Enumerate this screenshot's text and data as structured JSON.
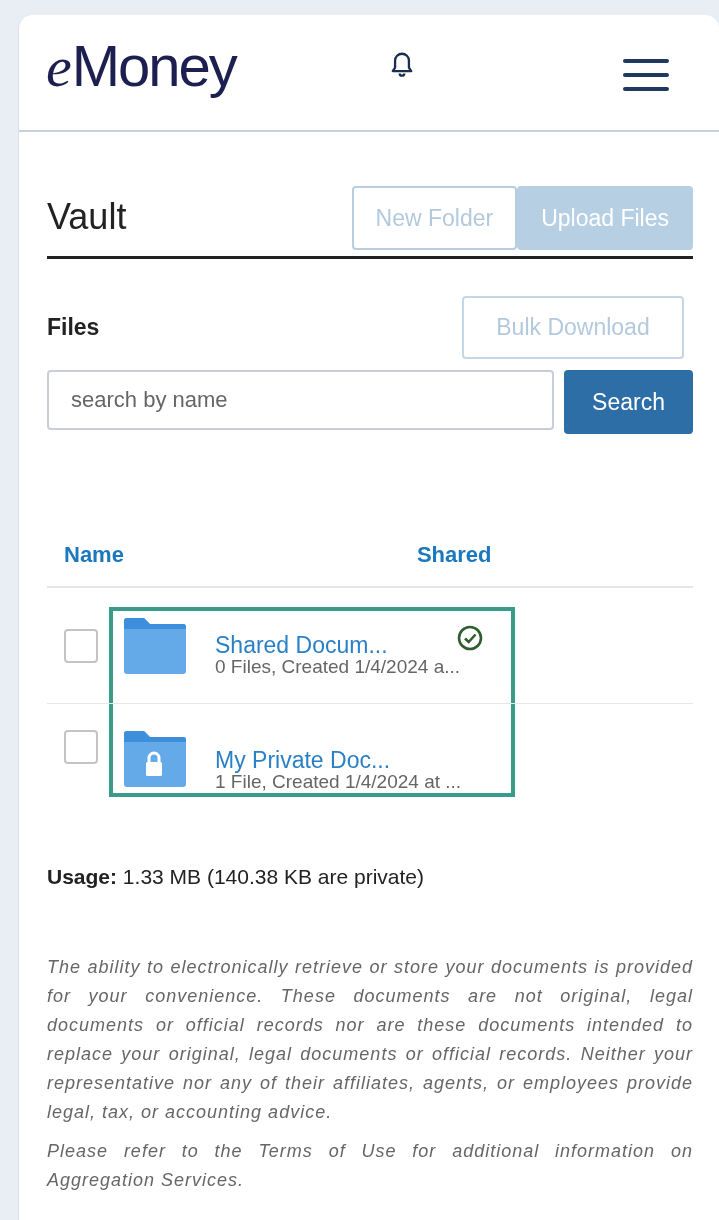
{
  "header": {
    "logo": "eMoney"
  },
  "vault": {
    "title": "Vault",
    "buttons": [
      {
        "label": "New Folder",
        "kind": "outline"
      },
      {
        "label": "Upload Files",
        "kind": "filled"
      }
    ]
  },
  "files": {
    "title": "Files",
    "bulk_button": "Bulk Download",
    "search": {
      "placeholder": "search by name",
      "button": "Search"
    }
  },
  "table": {
    "columns": [
      "Name",
      "Shared"
    ],
    "rows": [
      {
        "name": "Shared Docum...",
        "meta": "0 Files, Created 1/4/2024 a...",
        "checked": false,
        "locked": false,
        "shared": true
      },
      {
        "name": "My Private Doc...",
        "meta": "1 File, Created 1/4/2024 at ...",
        "checked": false,
        "locked": true,
        "shared": false
      }
    ]
  },
  "usage": "**Usage:** 1.33 MB (140.38 KB are private)",
  "disclaimer": [
    "The ability to electronically retrieve or store your documents is provided for your convenience. These documents are not original, legal documents or official records nor are these documents intended to replace your original, legal documents or official records. Neither your representative nor any of their affiliates, agents, or employees provide legal, tax, or accounting advice.",
    "Please refer to the Terms of Use for additional information on Aggregation Services."
  ]
}
